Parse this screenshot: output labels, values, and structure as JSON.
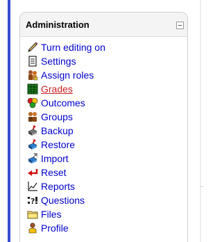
{
  "block": {
    "title": "Administration",
    "collapse_icon": "collapse-minus-icon"
  },
  "menu": {
    "items": [
      {
        "label": "Turn editing on",
        "icon": "edit-pencil-icon"
      },
      {
        "label": "Settings",
        "icon": "settings-document-icon"
      },
      {
        "label": "Assign roles",
        "icon": "assign-roles-icon"
      },
      {
        "label": "Grades",
        "icon": "grades-table-icon",
        "active": true
      },
      {
        "label": "Outcomes",
        "icon": "outcomes-icon"
      },
      {
        "label": "Groups",
        "icon": "groups-icon"
      },
      {
        "label": "Backup",
        "icon": "backup-icon"
      },
      {
        "label": "Restore",
        "icon": "restore-icon"
      },
      {
        "label": "Import",
        "icon": "import-icon"
      },
      {
        "label": "Reset",
        "icon": "reset-arrow-icon"
      },
      {
        "label": "Reports",
        "icon": "reports-chart-icon"
      },
      {
        "label": "Questions",
        "icon": "questions-icon"
      },
      {
        "label": "Files",
        "icon": "folder-icon"
      },
      {
        "label": "Profile",
        "icon": "profile-icon"
      }
    ]
  },
  "colors": {
    "link": "#0000cc",
    "active_link": "#cc2222",
    "accent_bar": "#3a4ccf",
    "header_bg": "#f4f4f4"
  }
}
